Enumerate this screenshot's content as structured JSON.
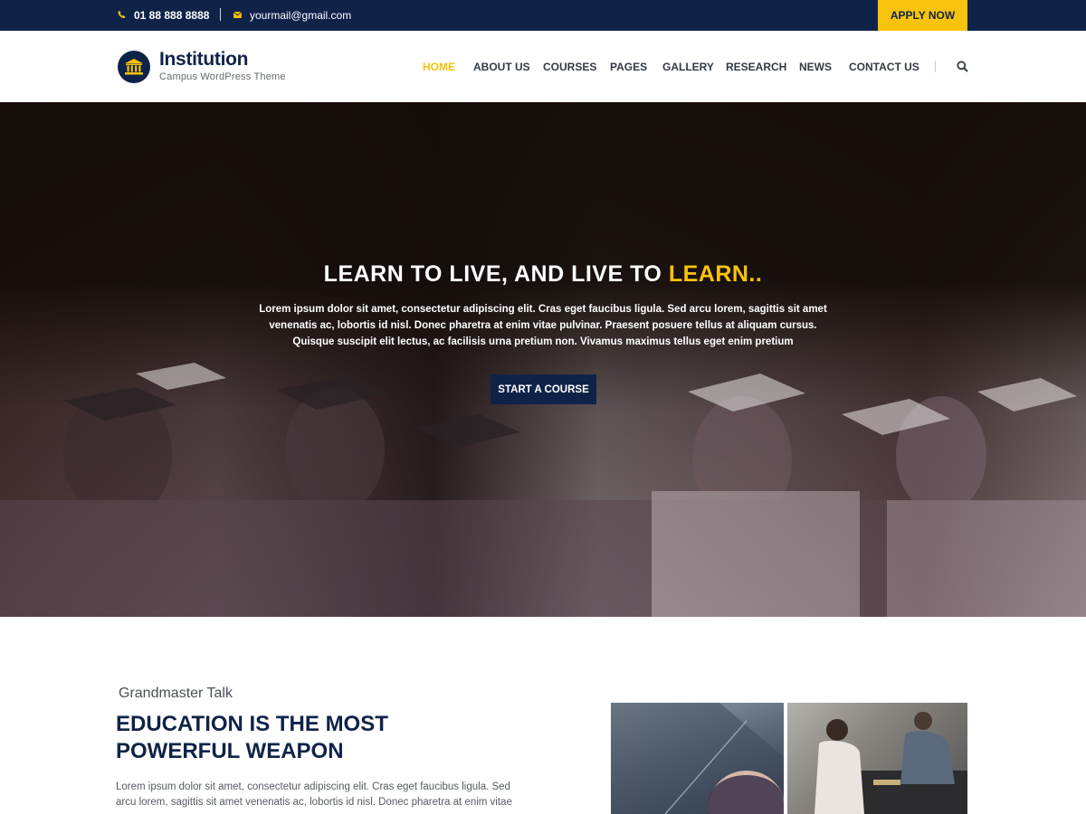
{
  "topbar": {
    "phone_icon": "phone-icon",
    "phone": "01 88 888 8888",
    "email_icon": "envelope-icon",
    "email": "yourmail@gmail.com",
    "apply_label": "APPLY NOW"
  },
  "brand": {
    "logo_icon": "institution-building-icon",
    "title": "Institution",
    "tagline": "Campus WordPress Theme"
  },
  "nav": {
    "items": [
      {
        "label": "HOME",
        "active": true
      },
      {
        "label": "ABOUT US"
      },
      {
        "label": "COURSES"
      },
      {
        "label": "PAGES"
      },
      {
        "label": "GALLERY"
      },
      {
        "label": "RESEARCH"
      },
      {
        "label": "NEWS"
      },
      {
        "label": "CONTACT US"
      }
    ],
    "search_icon": "search-icon"
  },
  "hero": {
    "headline_main": "LEARN TO LIVE, AND LIVE TO ",
    "headline_highlight": "LEARN..",
    "text": "Lorem ipsum dolor sit amet, consectetur adipiscing elit. Cras eget faucibus ligula. Sed arcu lorem, sagittis sit amet venenatis ac, lobortis id nisl. Donec pharetra at enim vitae pulvinar. Praesent posuere tellus at aliquam cursus. Quisque suscipit elit lectus, ac facilisis urna pretium non. Vivamus maximus tellus eget enim pretium",
    "button_label": "START A COURSE"
  },
  "about": {
    "kicker": "Grandmaster Talk",
    "title": "EDUCATION IS THE MOST POWERFUL WEAPON",
    "text": "Lorem ipsum dolor sit amet, consectetur adipiscing elit. Cras eget faucibus ligula. Sed arcu lorem, sagittis sit amet venenatis ac, lobortis id nisl. Donec pharetra at enim vitae"
  },
  "colors": {
    "navy": "#0f2348",
    "accent_yellow": "#f8c30c"
  }
}
